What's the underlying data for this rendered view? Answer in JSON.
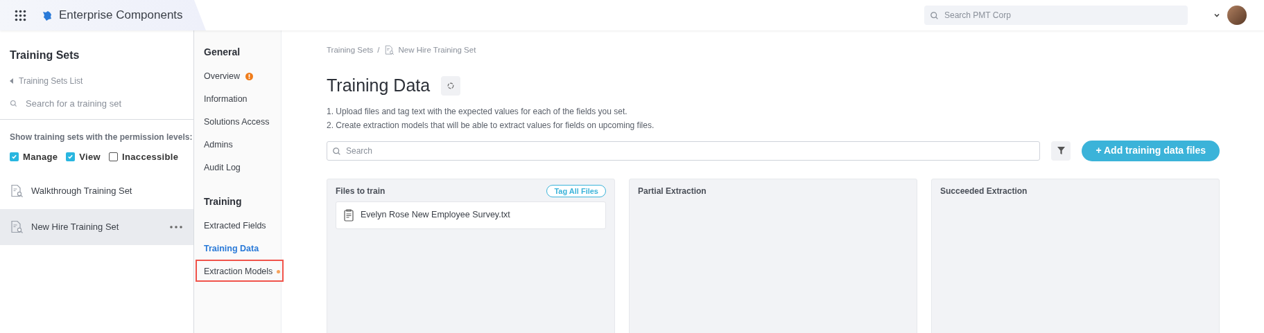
{
  "header": {
    "app_title": "Enterprise Components",
    "search": {
      "placeholder": "Search PMT Corp"
    }
  },
  "sidebar": {
    "title": "Training Sets",
    "back_link": "Training Sets List",
    "search": {
      "placeholder": "Search for a training set"
    },
    "filter_label": "Show training sets with the permission levels:",
    "filters": [
      {
        "label": "Manage",
        "checked": true
      },
      {
        "label": "View",
        "checked": true
      },
      {
        "label": "Inaccessible",
        "checked": false
      }
    ],
    "items": [
      {
        "label": "Walkthrough Training Set",
        "selected": false
      },
      {
        "label": "New Hire Training Set",
        "selected": true
      }
    ]
  },
  "nav": {
    "sections": [
      {
        "title": "General",
        "items": [
          {
            "label": "Overview",
            "selected": false,
            "warning": true,
            "dot": false,
            "highlighted": false
          },
          {
            "label": "Information",
            "selected": false,
            "warning": false,
            "dot": false,
            "highlighted": false
          },
          {
            "label": "Solutions Access",
            "selected": false,
            "warning": false,
            "dot": false,
            "highlighted": false
          },
          {
            "label": "Admins",
            "selected": false,
            "warning": false,
            "dot": false,
            "highlighted": false
          },
          {
            "label": "Audit Log",
            "selected": false,
            "warning": false,
            "dot": false,
            "highlighted": false
          }
        ]
      },
      {
        "title": "Training",
        "items": [
          {
            "label": "Extracted Fields",
            "selected": false,
            "warning": false,
            "dot": false,
            "highlighted": false
          },
          {
            "label": "Training Data",
            "selected": true,
            "warning": false,
            "dot": false,
            "highlighted": false
          },
          {
            "label": "Extraction Models",
            "selected": false,
            "warning": false,
            "dot": true,
            "highlighted": true
          }
        ]
      }
    ]
  },
  "main": {
    "breadcrumb": {
      "parent": "Training Sets",
      "separator": "/",
      "current": "New Hire Training Set"
    },
    "title": "Training Data",
    "instructions": [
      "1. Upload files and tag text with the expected values for each of the fields you set.",
      "2. Create extraction models that will be able to extract values for fields on upcoming files."
    ],
    "search": {
      "placeholder": "Search"
    },
    "add_button": "+ Add training data files",
    "columns": [
      {
        "title": "Files to train",
        "action": "Tag All Files",
        "files": [
          "Evelyn Rose New Employee Survey.txt"
        ]
      },
      {
        "title": "Partial Extraction"
      },
      {
        "title": "Succeeded Extraction"
      }
    ]
  }
}
